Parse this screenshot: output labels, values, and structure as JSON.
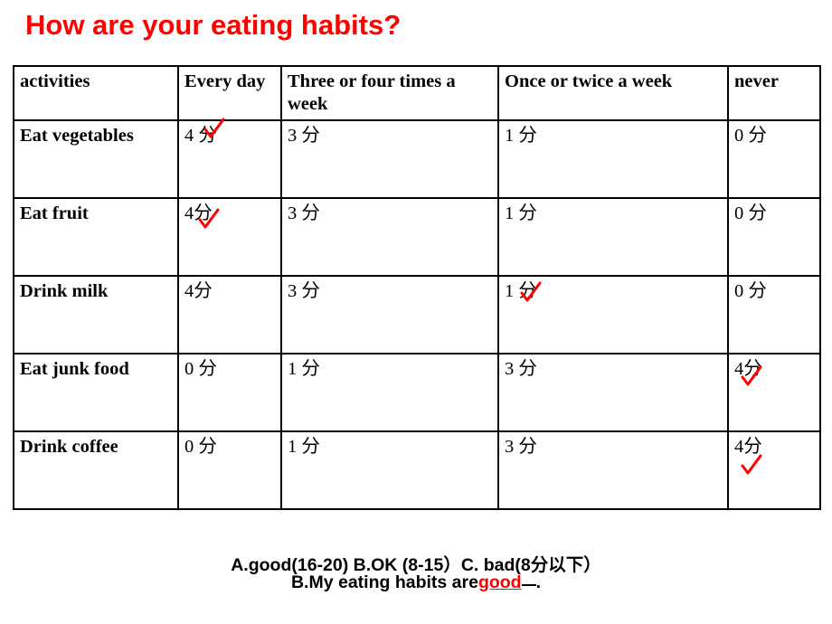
{
  "title": "How are your eating habits?",
  "table": {
    "headers": [
      "activities",
      "Every day",
      "Three or four times a week",
      "Once or twice a week",
      "never"
    ],
    "rows": [
      {
        "activity": "Eat vegetables",
        "values": [
          "4 分",
          "3 分",
          "1 分",
          "0 分"
        ],
        "checked": 0
      },
      {
        "activity": "Eat fruit",
        "values": [
          "4分",
          "3 分",
          "1 分",
          "0 分"
        ],
        "checked": 0
      },
      {
        "activity": "Drink milk",
        "values": [
          "4分",
          "3 分",
          "1 分",
          "0 分"
        ],
        "checked": 2
      },
      {
        "activity": "Eat junk food",
        "values": [
          "0 分",
          "1 分",
          "3 分",
          "4分"
        ],
        "checked": 3
      },
      {
        "activity": "Drink coffee",
        "values": [
          "0 分",
          "1 分",
          "3 分",
          "4分"
        ],
        "checked": 3
      }
    ]
  },
  "footer": {
    "line1": "A.good(16-20) B.OK (8-15）C. bad(8分以下）",
    "line2_prefix": "B.My eating habits are",
    "line2_answer": "good",
    "line2_suffix": "."
  },
  "colors": {
    "title": "#ff0000",
    "check": "#ff0000",
    "border": "#000000",
    "answer": "#ff0000"
  }
}
